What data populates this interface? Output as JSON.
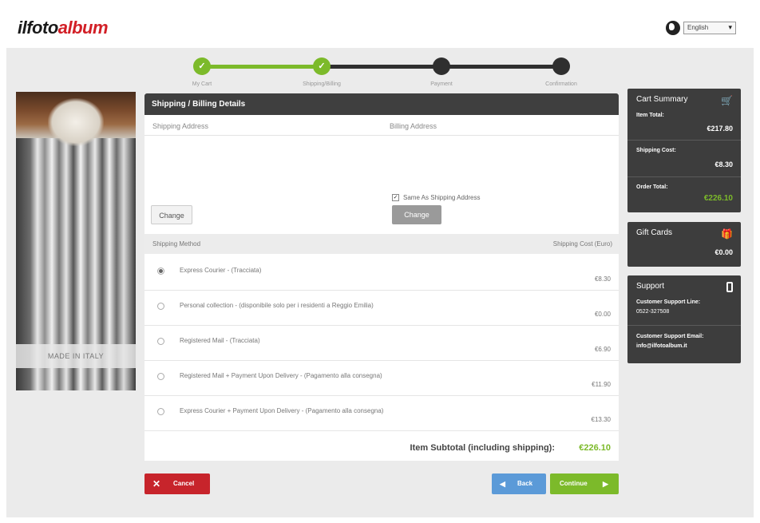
{
  "header": {
    "logo_part1": "ilfoto",
    "logo_part2": "album",
    "language": "English"
  },
  "steps": [
    {
      "label": "My Cart",
      "state": "done"
    },
    {
      "label": "Shipping/Billing",
      "state": "done"
    },
    {
      "label": "Payment",
      "state": "pending"
    },
    {
      "label": "Confirmation",
      "state": "pending"
    }
  ],
  "colors": {
    "accent_green": "#7cba2a",
    "dark": "#3f3f3f",
    "cancel_red": "#c7242b",
    "back_blue": "#5b9ad8"
  },
  "product": {
    "made_in": "MADE IN ITALY"
  },
  "details": {
    "title": "Shipping / Billing Details",
    "shipping_address_label": "Shipping Address",
    "billing_address_label": "Billing Address",
    "change_shipping_label": "Change",
    "change_billing_label": "Change",
    "same_as_shipping_label": "Same As Shipping Address",
    "same_as_shipping_checked": true
  },
  "shipping": {
    "method_header": "Shipping Method",
    "cost_header": "Shipping Cost (Euro)",
    "options": [
      {
        "label": "Express Courier - (Tracciata)",
        "cost": "€8.30",
        "selected": true
      },
      {
        "label": "Personal collection - (disponibile solo per i residenti a Reggio Emilia)",
        "cost": "€0.00",
        "selected": false
      },
      {
        "label": "Registered Mail - (Tracciata)",
        "cost": "€6.90",
        "selected": false
      },
      {
        "label": "Registered Mail + Payment Upon Delivery - (Pagamento alla consegna)",
        "cost": "€11.90",
        "selected": false
      },
      {
        "label": "Express Courier + Payment Upon Delivery - (Pagamento alla consegna)",
        "cost": "€13.30",
        "selected": false
      }
    ],
    "subtotal_label": "Item Subtotal (including shipping):",
    "subtotal_value": "€226.10"
  },
  "buttons": {
    "cancel": "Cancel",
    "back": "Back",
    "continue": "Continue"
  },
  "cart_summary": {
    "title": "Cart Summary",
    "item_total_label": "Item Total:",
    "item_total_value": "€217.80",
    "shipping_cost_label": "Shipping Cost:",
    "shipping_cost_value": "€8.30",
    "order_total_label": "Order Total:",
    "order_total_value": "€226.10"
  },
  "gift_cards": {
    "title": "Gift Cards",
    "value": "€0.00"
  },
  "support": {
    "title": "Support",
    "line_label": "Customer Support Line:",
    "line_value": "0522-327508",
    "email_label": "Customer Support Email:",
    "email_value": "info@ilfotoalbum.it"
  }
}
